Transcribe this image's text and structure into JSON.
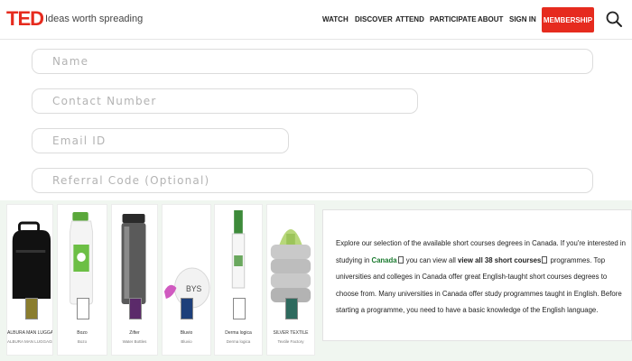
{
  "header": {
    "logo": "TED",
    "tagline": "Ideas worth spreading",
    "nav": [
      "WATCH",
      "DISCOVER",
      "ATTEND",
      "PARTICIPATE",
      "ABOUT",
      "SIGN IN"
    ],
    "membership_label": "MEMBERSHIP",
    "search_icon": "search-icon"
  },
  "form": {
    "name_placeholder": "Name",
    "contact_placeholder": "Contact Number",
    "email_placeholder": "Email ID",
    "referral_placeholder": "Referral Code (Optional)"
  },
  "products": [
    {
      "name": "ALBURA MAN LUGGAGE",
      "sub": "ALBURA MAN LUGGAGE"
    },
    {
      "name": "Bozo",
      "sub": "Bozo"
    },
    {
      "name": "Zifter",
      "sub": "Water Bottles"
    },
    {
      "name": "Bluvio",
      "sub": "Bluvio"
    },
    {
      "name": "Derma logica",
      "sub": "Derma logica"
    },
    {
      "name": "SILVER TEXTILE",
      "sub": "Textile Factory"
    }
  ],
  "info": {
    "text1": "Explore our selection of the available short courses degrees in Canada. If you're interested in studying in",
    "canada": "Canada",
    "text2": "you can view all",
    "view_link": "view all 38 short courses",
    "text3": "programmes. Top universities and colleges in Canada offer great English-taught short courses degrees to choose from. Many universities in Canada offer study programmes taught in English. Before starting a programme, you need to have a basic knowledge of the English language."
  },
  "colors": {
    "brand_red": "#e62b1e",
    "link_green": "#1a7a2e",
    "lower_bg": "#f0f6f0"
  }
}
